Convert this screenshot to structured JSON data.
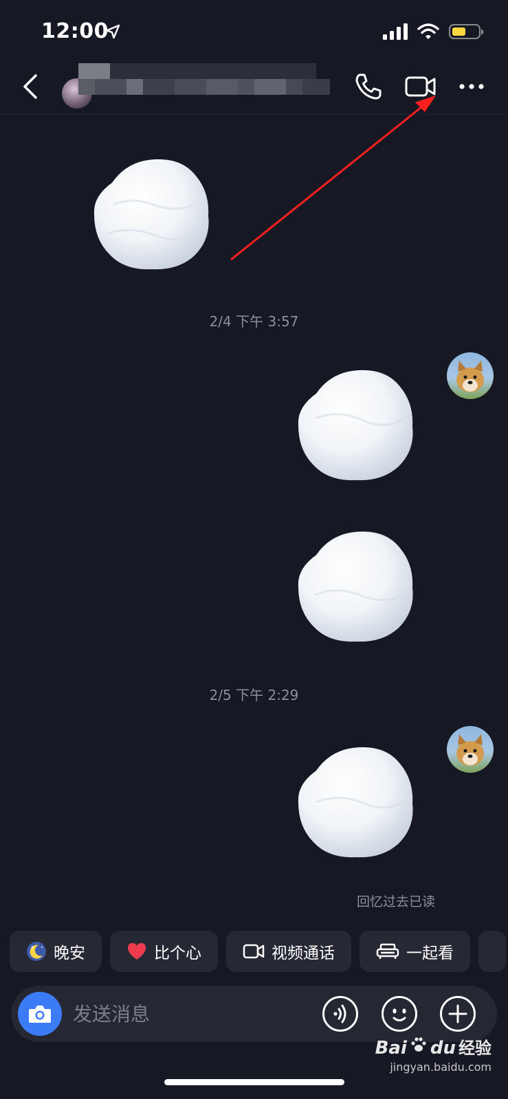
{
  "status_bar": {
    "time": "12:00"
  },
  "chat": {
    "timestamps": [
      "2/4 下午 3:57",
      "2/5 下午 2:29"
    ],
    "read_status": "回忆过去已读"
  },
  "quick_actions": [
    {
      "label": "晚安",
      "icon": "moon-emoji"
    },
    {
      "label": "比个心",
      "icon": "heart-emoji"
    },
    {
      "label": "视频通话",
      "icon": "video-camera-icon"
    },
    {
      "label": "一起看",
      "icon": "sofa-icon"
    }
  ],
  "composer": {
    "placeholder": "发送消息"
  },
  "watermark": {
    "brand": "Bai",
    "brand2": "du",
    "suffix": "经验",
    "url": "jingyan.baidu.com"
  },
  "colors": {
    "background": "#161823",
    "accent": "#3b7cf6",
    "annotation_arrow": "#ff1f1f",
    "battery": "#ffd740"
  }
}
